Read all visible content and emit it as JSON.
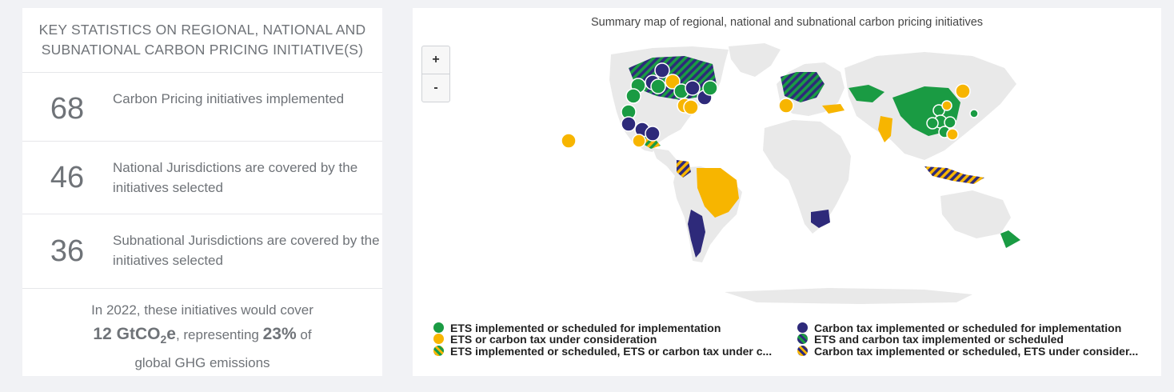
{
  "stats": {
    "header": "KEY STATISTICS ON REGIONAL, NATIONAL AND SUBNATIONAL CARBON PRICING INITIATIVE(S)",
    "rows": [
      {
        "number": "68",
        "text": "Carbon Pricing initiatives implemented"
      },
      {
        "number": "46",
        "text": "National Jurisdictions are covered by the initiatives selected"
      },
      {
        "number": "36",
        "text": "Subnational Jurisdictions are covered by the initiatives selected"
      }
    ],
    "summary": {
      "line1": "In 2022, these initiatives would cover",
      "emissions": "12 GtCO",
      "subscript": "2",
      "emissions_suffix": "e",
      "representing": ", representing ",
      "percent": "23%",
      "of": " of",
      "line3": "global GHG emissions"
    }
  },
  "map": {
    "title": "Summary map of regional, national and subnational carbon pricing initiatives",
    "zoom_in": "+",
    "zoom_out": "-",
    "colors": {
      "ets": "#1a9b43",
      "consideration": "#f7b500",
      "tax": "#2e2a7a",
      "land": "#e9e9e9"
    },
    "legend": [
      {
        "label": "ETS implemented or scheduled for implementation",
        "style": "ets"
      },
      {
        "label": "ETS or carbon tax under consideration",
        "style": "consideration"
      },
      {
        "label": "ETS implemented or scheduled, ETS or carbon tax under c...",
        "style": "ets-consideration"
      },
      {
        "label": "Carbon tax implemented or scheduled for implementation",
        "style": "tax"
      },
      {
        "label": "ETS and carbon tax implemented or scheduled",
        "style": "ets-tax"
      },
      {
        "label": "Carbon tax implemented or scheduled, ETS under consider...",
        "style": "tax-consideration"
      }
    ]
  }
}
